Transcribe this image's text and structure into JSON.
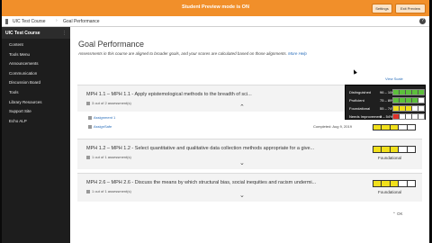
{
  "preview": {
    "message": "Student Preview mode is ON",
    "settings_label": "Settings",
    "exit_label": "Exit Preview"
  },
  "nav": {
    "course": "UIC Test Course",
    "page": "Goal Performance",
    "help": "?"
  },
  "sidebar": {
    "title": "UIC Test Course",
    "items": [
      {
        "label": "Content"
      },
      {
        "label": "Tools Menu"
      },
      {
        "label": "Announcements"
      },
      {
        "label": "Communication"
      },
      {
        "label": "Discussion Board"
      },
      {
        "label": "Tools"
      },
      {
        "label": "Library Resources"
      },
      {
        "label": "Support Site"
      },
      {
        "label": "Echo ALP"
      }
    ]
  },
  "main": {
    "title": "Goal Performance",
    "description": "Assessments in this course are aligned to broader goals, and your scores are calculated based on those alignments.",
    "more_help": "More Help",
    "view_label": "View Scale",
    "ok_label": "OK"
  },
  "goals": [
    {
      "heading": "MPH 1.1 – MPH 1.1 - Apply epistemological methods to the breadth of sci...",
      "count": "3 out of 2 assessment(s)",
      "level": "",
      "rows": [
        {
          "label": "Assignment 1",
          "date": ""
        },
        {
          "label": "AssignSafe",
          "date": "Completed: Aug 9, 2019"
        }
      ]
    },
    {
      "heading": "MPH 1.2 – MPH 1.2 - Select quantitative and qualitative data collection methods appropriate for a give...",
      "count": "1 out of 1 assessment(s)",
      "level": "Foundational"
    },
    {
      "heading": "MPH 2.6 – MPH 2.6 - Discuss the means by which structural bias, social inequities and racism undermi...",
      "count": "1 out of 1 assessment(s)",
      "level": "Foundational"
    }
  ],
  "legend": {
    "rows": [
      {
        "name": "Distinguished",
        "range": "96 – 100%",
        "fill": 5,
        "color": "#5cbf3b"
      },
      {
        "name": "Proficient",
        "range": "75 – 89%",
        "fill": 4,
        "color": "#5cbf3b"
      },
      {
        "name": "Foundational",
        "range": "55 – 74%",
        "fill": 3,
        "color": "#f1e01c"
      },
      {
        "name": "Needs Improvement",
        "range": "0 – 54%",
        "fill": 1,
        "color": "#e0322a"
      }
    ]
  },
  "colors": {
    "preview_bar": "#f18f2a",
    "sidebar": "#1d1d1d",
    "link": "#2a6ebb"
  }
}
